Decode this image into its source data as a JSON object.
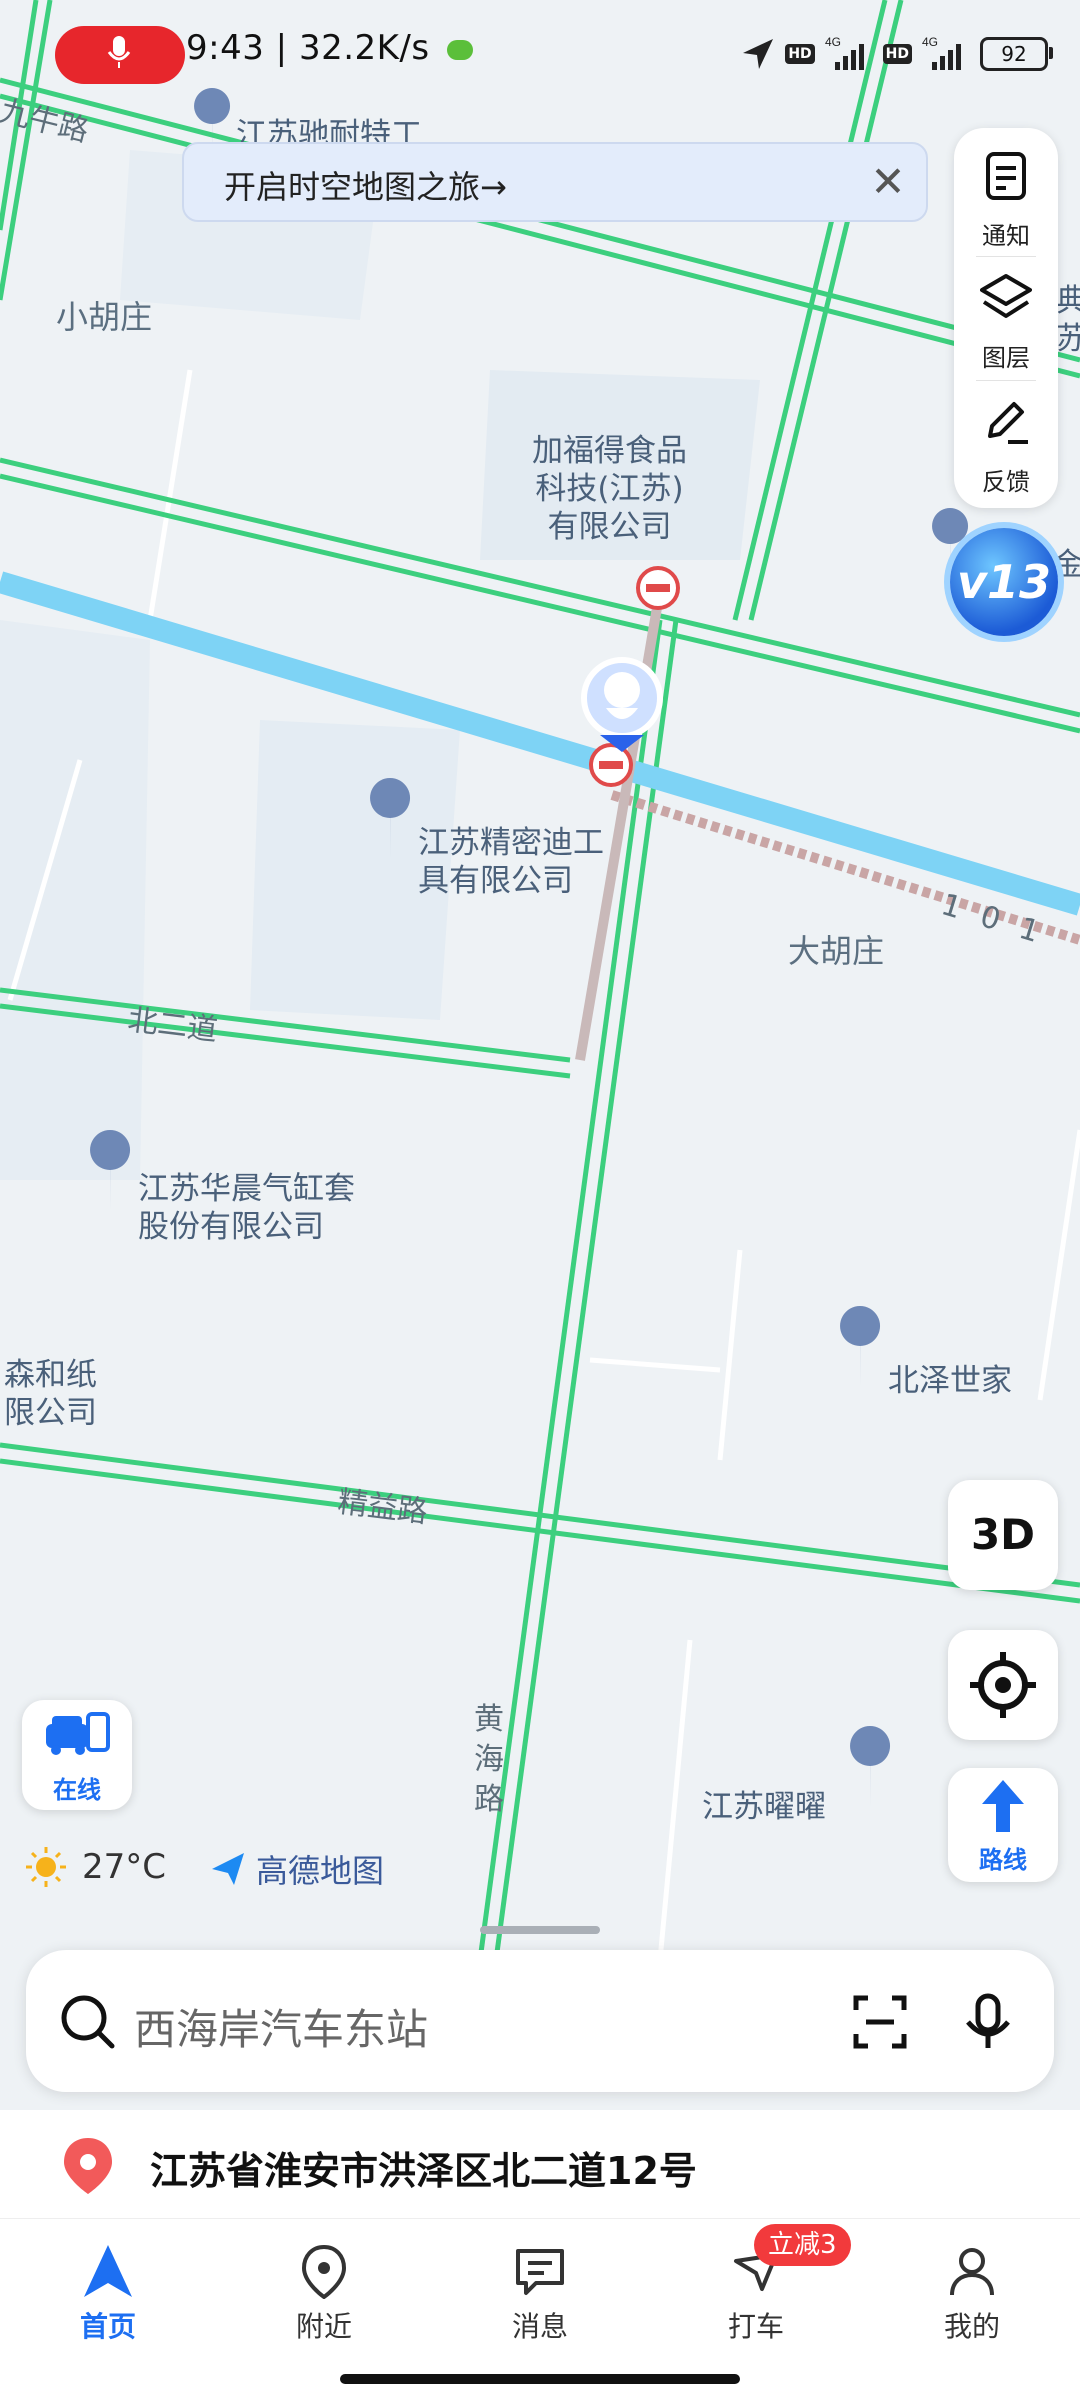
{
  "status_bar": {
    "time": "9:43",
    "net_speed": "32.2K/s",
    "battery": "92",
    "signal": [
      "4G",
      "4G"
    ]
  },
  "banner": {
    "text": "开启时空地图之旅→"
  },
  "tools": [
    {
      "label": "通知",
      "icon": "note-icon"
    },
    {
      "label": "图层",
      "icon": "layers-icon"
    },
    {
      "label": "反馈",
      "icon": "pen-icon"
    }
  ],
  "level_badge": {
    "text": "v13"
  },
  "map": {
    "places": {
      "xiaohuzhuang": "小胡庄",
      "dahuzhuang": "大胡庄"
    },
    "roads": {
      "jiuniu": "九牛路",
      "beierdao": "北二道",
      "jingyi": "精益路",
      "huanghai": "黄海路",
      "road_101": "1 0 1"
    },
    "pois": {
      "jiafude": "加福得食品\n科技(江苏)\n有限公司",
      "jingmi": "江苏精密迪工\n具有限公司",
      "huachen": "江苏华晨气缸套\n股份有限公司",
      "beize": "北泽世家",
      "yaoyao": "江苏曜曜",
      "senhe": "森和纸\n限公司",
      "chinai": "江苏驰耐特工",
      "edge1": "典\n苏",
      "edge2": "金"
    }
  },
  "controls": {
    "three_d": "3D",
    "route": "路线",
    "online": "在线"
  },
  "weather": {
    "temp": "27°C"
  },
  "brand": {
    "name": "高德地图"
  },
  "search": {
    "placeholder": "西海岸汽车东站"
  },
  "address": {
    "text": "江苏省淮安市洪泽区北二道12号"
  },
  "tabs": [
    {
      "label": "首页",
      "active": true
    },
    {
      "label": "附近"
    },
    {
      "label": "消息"
    },
    {
      "label": "打车",
      "badge": "立减3"
    },
    {
      "label": "我的"
    }
  ],
  "colors": {
    "accent": "#1d6ff2",
    "road": "#3ccf7e",
    "water": "#7ed3f5",
    "badge": "#f23a3c"
  }
}
